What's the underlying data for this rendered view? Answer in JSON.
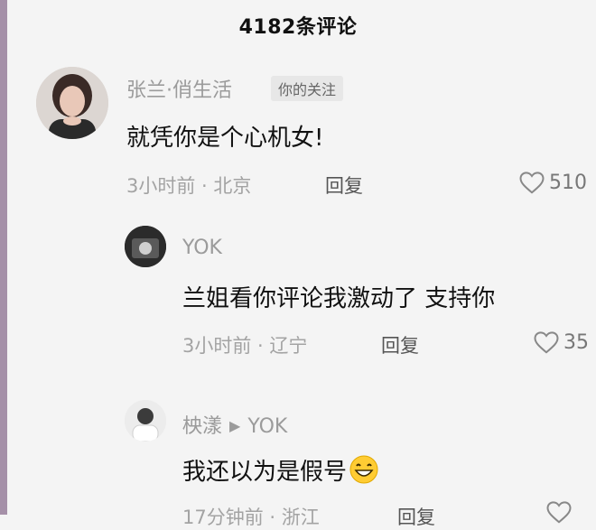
{
  "header": {
    "title": "4182条评论"
  },
  "comments": [
    {
      "author": "张兰·俏生活",
      "badge": "你的关注",
      "content": "就凭你是个心机女!",
      "time_location": "3小时前 · 北京",
      "reply_label": "回复",
      "likes": "510"
    },
    {
      "author": "YOK",
      "content": "兰姐看你评论我激动了 支持你",
      "time_location": "3小时前 · 辽宁",
      "reply_label": "回复",
      "likes": "35"
    },
    {
      "author": "柍漾",
      "reply_to": "YOK",
      "content": "我还以为是假号",
      "time_location": "17分钟前 · 浙江",
      "reply_label": "回复"
    }
  ],
  "icons": {
    "like": "heart-outline-icon",
    "emoji": "grinning-face-emoji",
    "reply_arrow": "triangle-right-icon"
  },
  "colors": {
    "meta_gray": "#a3a3a3",
    "text": "#111111",
    "badge_bg": "#e7e7e7"
  }
}
